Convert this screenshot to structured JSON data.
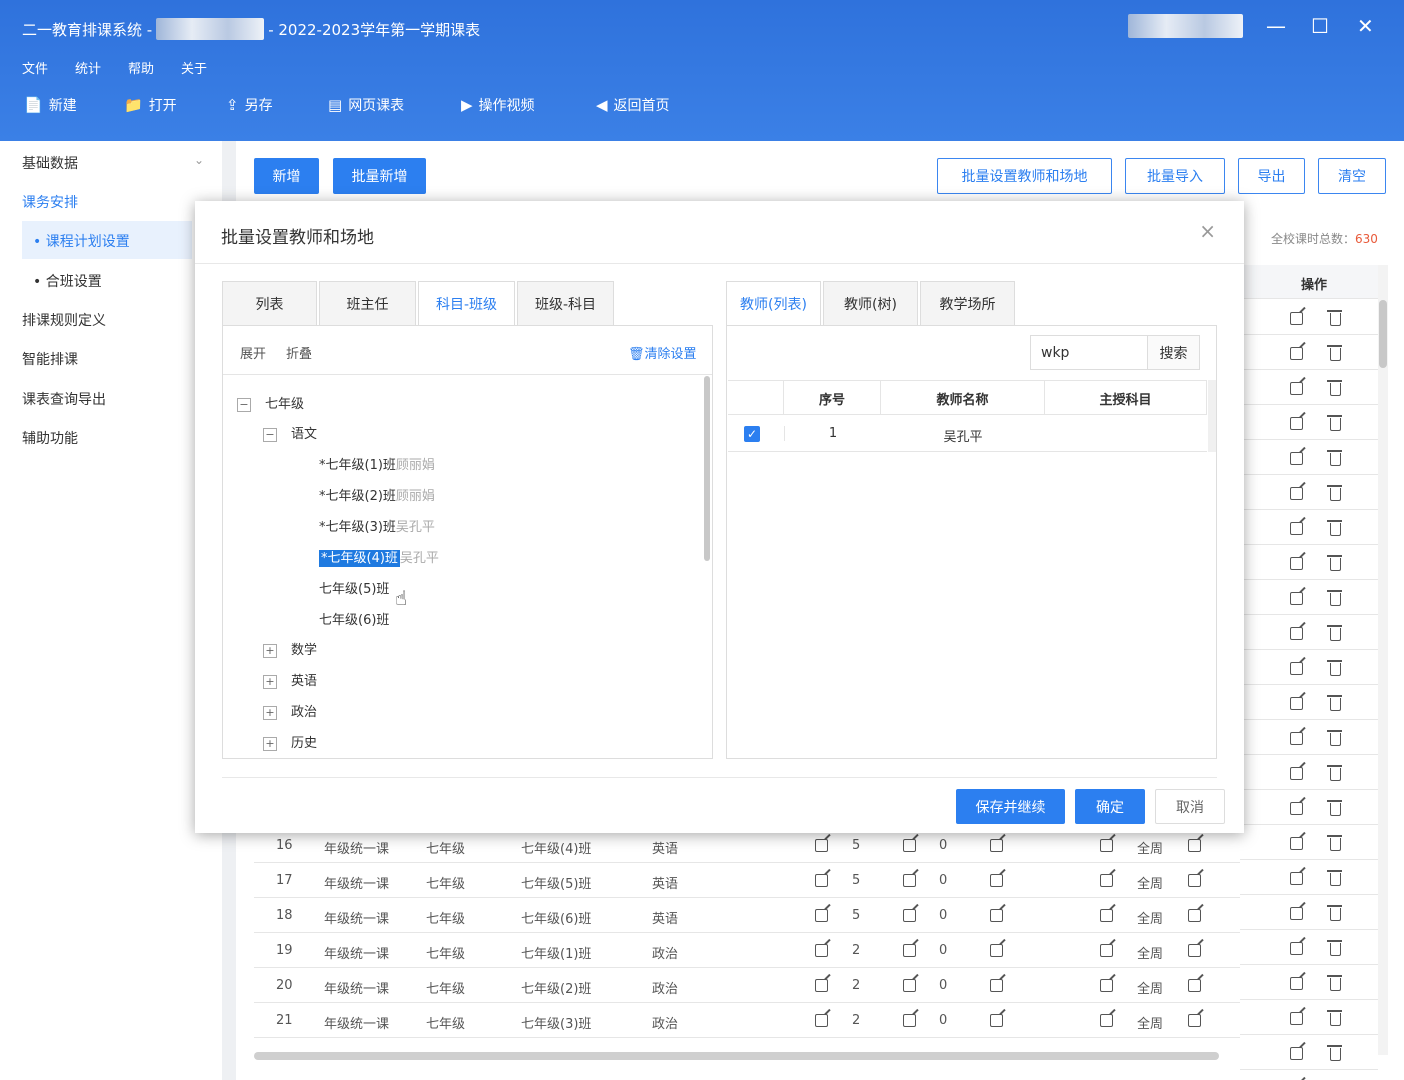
{
  "window": {
    "title_prefix": "二一教育排课系统 -",
    "title_suffix": "- 2022-2023学年第一学期课表",
    "minimize": "—",
    "maximize": "☐",
    "close": "✕"
  },
  "menu": [
    "文件",
    "统计",
    "帮助",
    "关于"
  ],
  "toolbar": {
    "new": "新建",
    "open": "打开",
    "save_as": "另存",
    "web_schedule": "网页课表",
    "video": "操作视频",
    "home": "返回首页"
  },
  "sidebar": {
    "basic_data": "基础数据",
    "course_arrangement": "课务安排",
    "course_plan": "课程计划设置",
    "merge_class": "合班设置",
    "rules": "排课规则定义",
    "smart": "智能排课",
    "query": "课表查询导出",
    "aux": "辅助功能"
  },
  "actions": {
    "add": "新增",
    "batch_add": "批量新增",
    "batch_set": "批量设置教师和场地",
    "batch_import": "批量导入",
    "export": "导出",
    "clear": "清空"
  },
  "total": {
    "label": "全校课时总数：",
    "value": "630"
  },
  "op_header": "操作",
  "op_row_count": 23,
  "table_rows": [
    {
      "no": "16",
      "type": "年级统一课",
      "grade": "七年级",
      "class": "七年级(4)班",
      "subject": "英语",
      "hours": "5",
      "zero": "0",
      "week": "全周"
    },
    {
      "no": "17",
      "type": "年级统一课",
      "grade": "七年级",
      "class": "七年级(5)班",
      "subject": "英语",
      "hours": "5",
      "zero": "0",
      "week": "全周"
    },
    {
      "no": "18",
      "type": "年级统一课",
      "grade": "七年级",
      "class": "七年级(6)班",
      "subject": "英语",
      "hours": "5",
      "zero": "0",
      "week": "全周"
    },
    {
      "no": "19",
      "type": "年级统一课",
      "grade": "七年级",
      "class": "七年级(1)班",
      "subject": "政治",
      "hours": "2",
      "zero": "0",
      "week": "全周"
    },
    {
      "no": "20",
      "type": "年级统一课",
      "grade": "七年级",
      "class": "七年级(2)班",
      "subject": "政治",
      "hours": "2",
      "zero": "0",
      "week": "全周"
    },
    {
      "no": "21",
      "type": "年级统一课",
      "grade": "七年级",
      "class": "七年级(3)班",
      "subject": "政治",
      "hours": "2",
      "zero": "0",
      "week": "全周"
    }
  ],
  "modal": {
    "title": "批量设置教师和场地",
    "close": "×",
    "left_tabs": [
      "列表",
      "班主任",
      "科目-班级",
      "班级-科目"
    ],
    "expand": "展开",
    "collapse": "折叠",
    "clear_settings": "清除设置",
    "tree": {
      "grade": "七年级",
      "subject": "语文",
      "classes": [
        {
          "name": "*七年级(1)班",
          "teacher": "顾丽娟"
        },
        {
          "name": "*七年级(2)班",
          "teacher": "顾丽娟"
        },
        {
          "name": "*七年级(3)班",
          "teacher": "吴孔平"
        },
        {
          "name": "*七年级(4)班",
          "teacher": "吴孔平"
        },
        {
          "name": "七年级(5)班",
          "teacher": ""
        },
        {
          "name": "七年级(6)班",
          "teacher": ""
        }
      ],
      "other_subjects": [
        "数学",
        "英语",
        "政治",
        "历史"
      ]
    },
    "right_tabs": [
      "教师(列表)",
      "教师(树)",
      "教学场所"
    ],
    "search_value": "wkp",
    "search_btn": "搜索",
    "table_headers": [
      "序号",
      "教师名称",
      "主授科目"
    ],
    "teachers": [
      {
        "no": "1",
        "name": "吴孔平",
        "subject": ""
      }
    ],
    "save_continue": "保存并继续",
    "ok": "确定",
    "cancel": "取消"
  }
}
